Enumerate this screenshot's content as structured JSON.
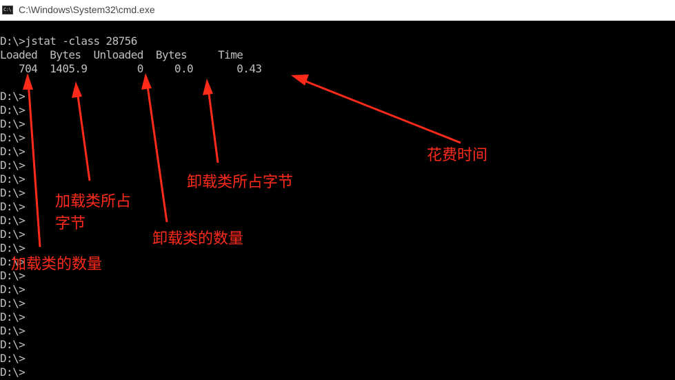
{
  "window": {
    "title": "C:\\Windows\\System32\\cmd.exe",
    "icon": "cmd-icon",
    "icon_text": "C:\\."
  },
  "console": {
    "command_line": "D:\\>jstat -class 28756",
    "header_line": "Loaded  Bytes  Unloaded  Bytes     Time",
    "values_line": "   704  1405.9        0     0.0       0.43",
    "columns": [
      "Loaded",
      "Bytes",
      "Unloaded",
      "Bytes",
      "Time"
    ],
    "values": [
      "704",
      "1405.9",
      "0",
      "0.0",
      "0.43"
    ],
    "prompt": "D:\\>",
    "prompt_count": 21,
    "text_color": "#c0c0c0",
    "background": "#000000"
  },
  "annotations": {
    "color": "#ff2a1a",
    "loaded_count": "加载类的数量",
    "loaded_bytes_line1": "加载类所占",
    "loaded_bytes_line2": "字节",
    "unloaded_count": "卸载类的数量",
    "unloaded_bytes": "卸载类所占字节",
    "time_spent": "花费时间"
  }
}
